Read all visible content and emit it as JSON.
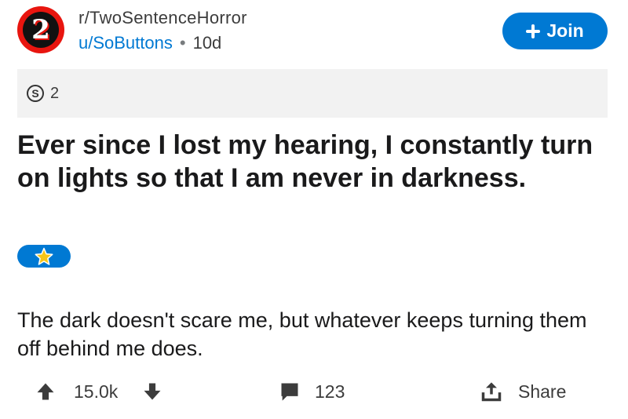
{
  "post": {
    "subreddit": "r/TwoSentenceHorror",
    "subreddit_icon_text": "2",
    "author": "u/SoButtons",
    "separator": "•",
    "age": "10d",
    "join_label": "Join",
    "award_count": "2",
    "award_icon_text": "S",
    "title": "Ever since I lost my hearing, I constantly turn on lights so that I am never in darkness.",
    "flair_icon": "star-icon",
    "body": "The dark doesn't scare me, but whatever keeps turning them off behind me does."
  },
  "actions": {
    "score": "15.0k",
    "comments": "123",
    "share_label": "Share"
  },
  "colors": {
    "accent": "#0079d3",
    "award_bar": "#f2f2f2",
    "text": "#1a1a1b",
    "subreddit_icon_red": "#e8150f",
    "star": "#f5c518"
  }
}
